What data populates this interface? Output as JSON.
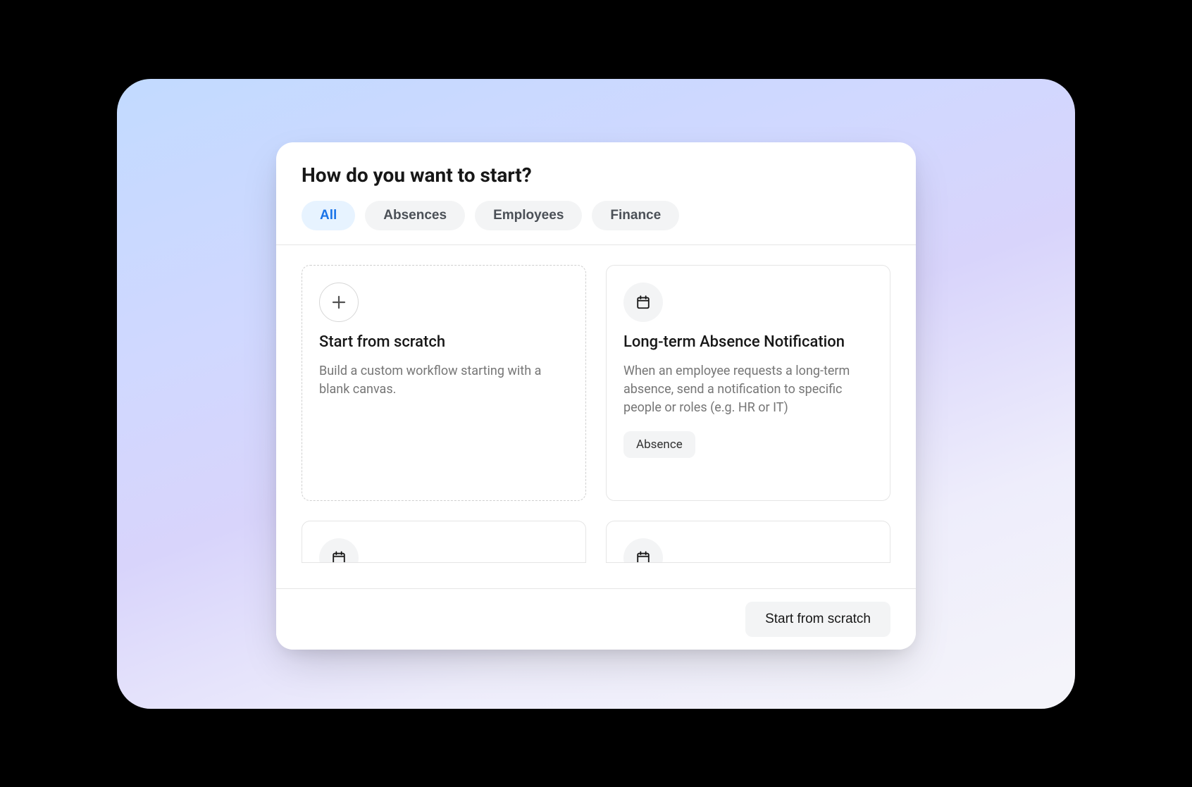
{
  "modal": {
    "title": "How do you want to start?",
    "filters": [
      {
        "label": "All",
        "active": true
      },
      {
        "label": "Absences",
        "active": false
      },
      {
        "label": "Employees",
        "active": false
      },
      {
        "label": "Finance",
        "active": false
      }
    ],
    "cards": [
      {
        "icon": "plus",
        "title": "Start from scratch",
        "description": "Build a custom workflow starting with a blank canvas.",
        "dashed": true,
        "tag": null
      },
      {
        "icon": "calendar",
        "title": "Long-term Absence Notification",
        "description": "When an employee requests a long-term absence, send a notification to specific people or roles (e.g. HR or IT)",
        "dashed": false,
        "tag": "Absence"
      }
    ],
    "footer_button": "Start from scratch"
  }
}
